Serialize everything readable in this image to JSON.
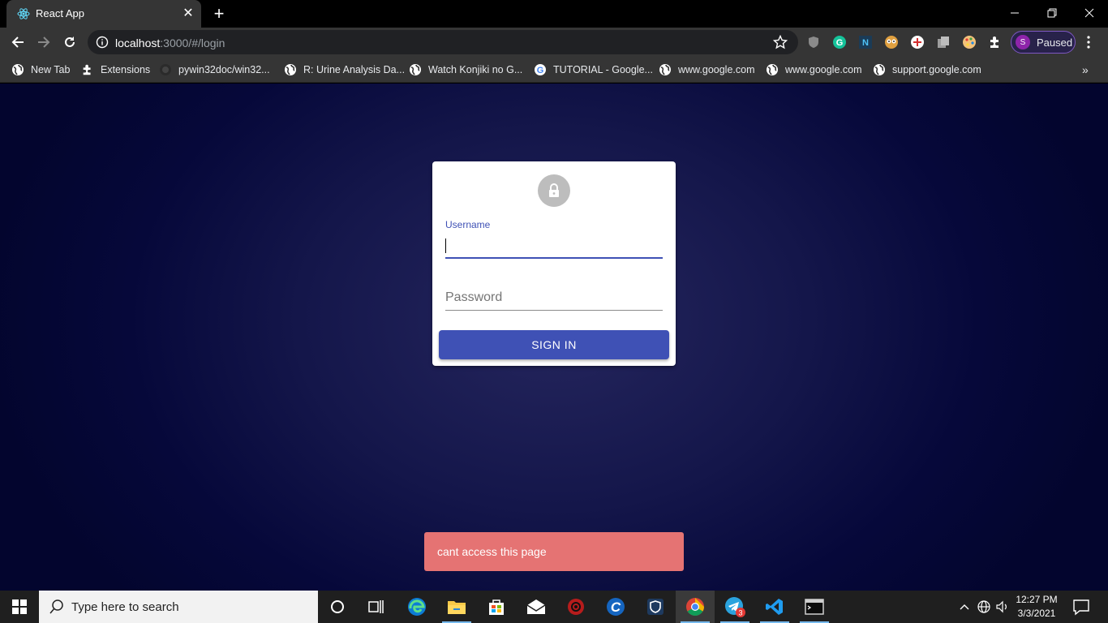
{
  "browser": {
    "tab_title": "React App",
    "url_host": "localhost",
    "url_rest": ":3000/#/login",
    "profile_initial": "S",
    "profile_label": "Paused"
  },
  "bookmarks": [
    {
      "label": "New Tab",
      "icon": "globe-icon"
    },
    {
      "label": "Extensions",
      "icon": "puzzle-icon"
    },
    {
      "label": "pywin32doc/win32...",
      "icon": "github-icon"
    },
    {
      "label": "R: Urine Analysis Da...",
      "icon": "globe-icon"
    },
    {
      "label": "Watch Konjiki no G...",
      "icon": "globe-icon"
    },
    {
      "label": "TUTORIAL - Google...",
      "icon": "google-icon"
    },
    {
      "label": "www.google.com",
      "icon": "globe-icon"
    },
    {
      "label": "www.google.com",
      "icon": "globe-icon"
    },
    {
      "label": "support.google.com",
      "icon": "globe-icon"
    }
  ],
  "login": {
    "username_label": "Username",
    "username_value": "",
    "password_placeholder": "Password",
    "signin_label": "SIGN IN",
    "accent_color": "#3f51b5"
  },
  "toast": {
    "message": "cant access this page",
    "color": "#e57373"
  },
  "taskbar": {
    "search_placeholder": "Type here to search",
    "time": "12:27 PM",
    "date": "3/3/2021",
    "telegram_badge": "3"
  }
}
